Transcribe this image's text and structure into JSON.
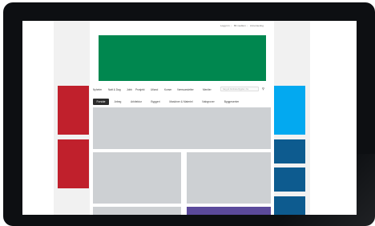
{
  "top_links": [
    "Logg inn",
    "Bli medlem",
    "Annonsering"
  ],
  "nav_items": [
    "Nyheter",
    "Natt & Dag",
    "Jobb",
    "Prosjekt",
    "Utland",
    "Kurser",
    "Værsvarsletter",
    "Meniter"
  ],
  "search": {
    "placeholder": "Søg på Nordiska Bygdet i fra"
  },
  "tabs": [
    "Forside",
    "Arbeg",
    "Arkitektur",
    "Byggeri",
    "Maskiner & Materiel",
    "Nabgrover",
    "Byggesenter"
  ],
  "active_tab": "Forside",
  "colors": {
    "banner": "#00874f",
    "ad_red": "#c0202c",
    "ad_light_blue": "#03a9f0",
    "ad_dark_blue": "#0d5b8f",
    "purple_block": "#5b4a9b",
    "placeholder_gray": "#cdd0d3"
  }
}
